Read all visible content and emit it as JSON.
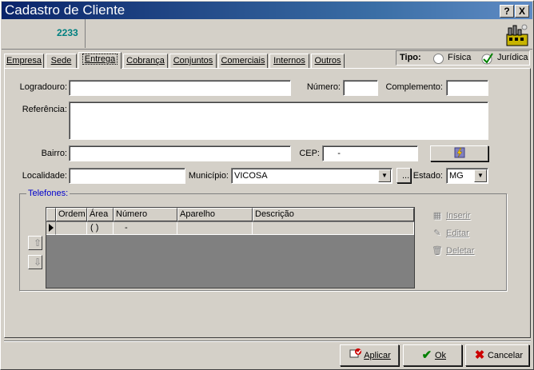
{
  "window": {
    "title": "Cadastro de Cliente",
    "help_btn": "?",
    "close_btn": "X"
  },
  "header": {
    "code": "2233",
    "logo_icon": "factory-icon"
  },
  "tabs": [
    {
      "label": "Empresa",
      "active": false
    },
    {
      "label": "Sede",
      "active": false
    },
    {
      "label": "Entrega",
      "active": true
    },
    {
      "label": "Cobrança",
      "active": false
    },
    {
      "label": "Conjuntos",
      "active": false
    },
    {
      "label": "Comerciais",
      "active": false
    },
    {
      "label": "Internos",
      "active": false
    },
    {
      "label": "Outros",
      "active": false
    }
  ],
  "tipo": {
    "label": "Tipo:",
    "fisica": "Física",
    "juridica": "Jurídica",
    "selected": "Jurídica"
  },
  "form": {
    "logradouro_label": "Logradouro:",
    "logradouro_value": "",
    "numero_label": "Número:",
    "numero_value": "",
    "complemento_label": "Complemento:",
    "complemento_value": "",
    "referencia_label": "Referência:",
    "referencia_value": "",
    "bairro_label": "Bairro:",
    "bairro_value": "",
    "cep_label": "CEP:",
    "cep_value": "     -",
    "localidade_label": "Localidade:",
    "localidade_value": "",
    "municipio_label": "Município:",
    "municipio_value": "VICOSA",
    "municipio_more": "...",
    "estado_label": "Estado:",
    "estado_value": "MG"
  },
  "telefones": {
    "title": "Telefones:",
    "columns": [
      "Ordem",
      "Área",
      "Número",
      "Aparelho",
      "Descrição"
    ],
    "row": {
      "ordem": "",
      "area": "( )",
      "numero": "-",
      "aparelho": "",
      "descricao": ""
    },
    "actions": {
      "inserir": "Inserir",
      "editar": "Editar",
      "deletar": "Deletar"
    }
  },
  "buttons": {
    "aplicar": "Aplicar",
    "ok": "Ok",
    "cancelar": "Cancelar"
  },
  "colors": {
    "title_bar": "#0a246a",
    "code_text": "#008080",
    "group_title": "#0000cc",
    "ok_check": "#008000",
    "cancel_x": "#cc0000"
  }
}
